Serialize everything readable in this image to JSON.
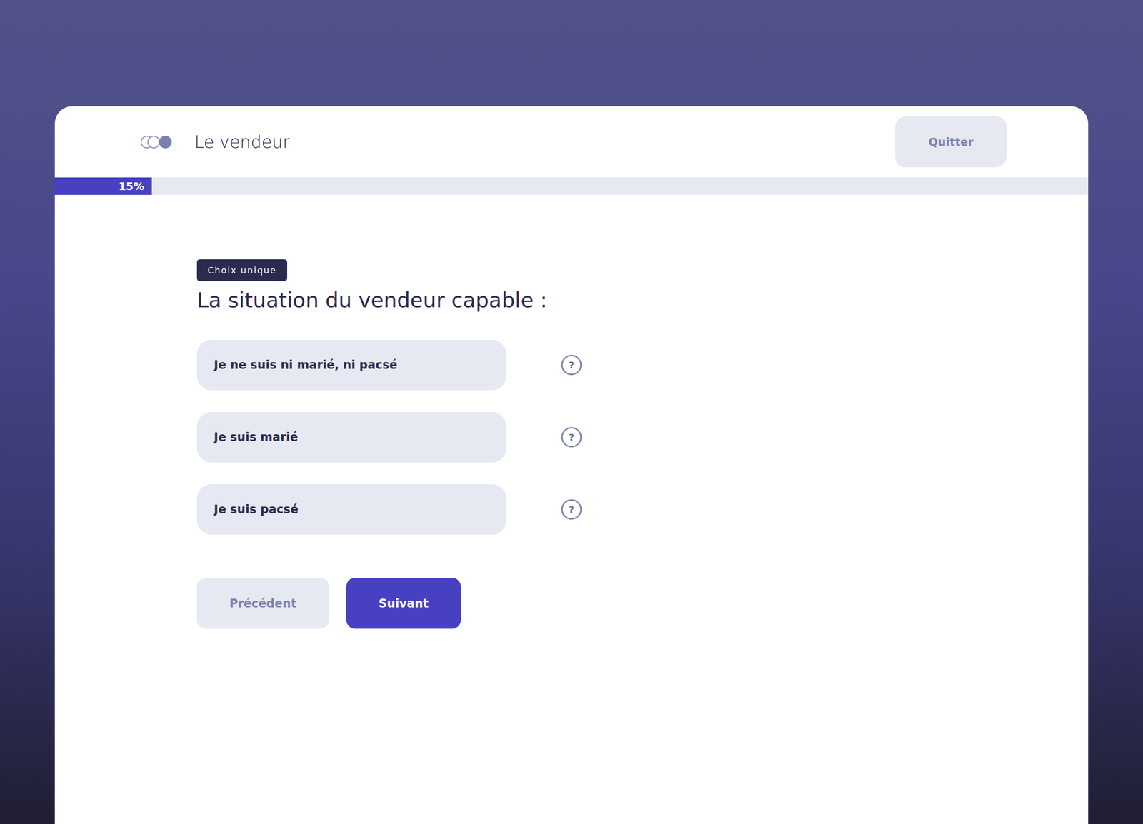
{
  "header": {
    "title": "Le vendeur",
    "quit_button": "Quitter"
  },
  "progress": {
    "level": 0.094,
    "reading": "15%"
  },
  "question": {
    "badge": "Choix unique",
    "title": "La situation du vendeur capable :"
  },
  "options": [
    {
      "label": "Je ne suis ni marié, ni pacsé",
      "selected": false,
      "help": "?"
    },
    {
      "label": "Je suis marié",
      "selected": false,
      "help": "?"
    },
    {
      "label": "Je suis pacsé",
      "selected": false,
      "help": "?"
    }
  ],
  "buttons": [
    {
      "label": "Précédent",
      "kind": "secondary"
    },
    {
      "label": "Suivant",
      "kind": "primary"
    }
  ]
}
